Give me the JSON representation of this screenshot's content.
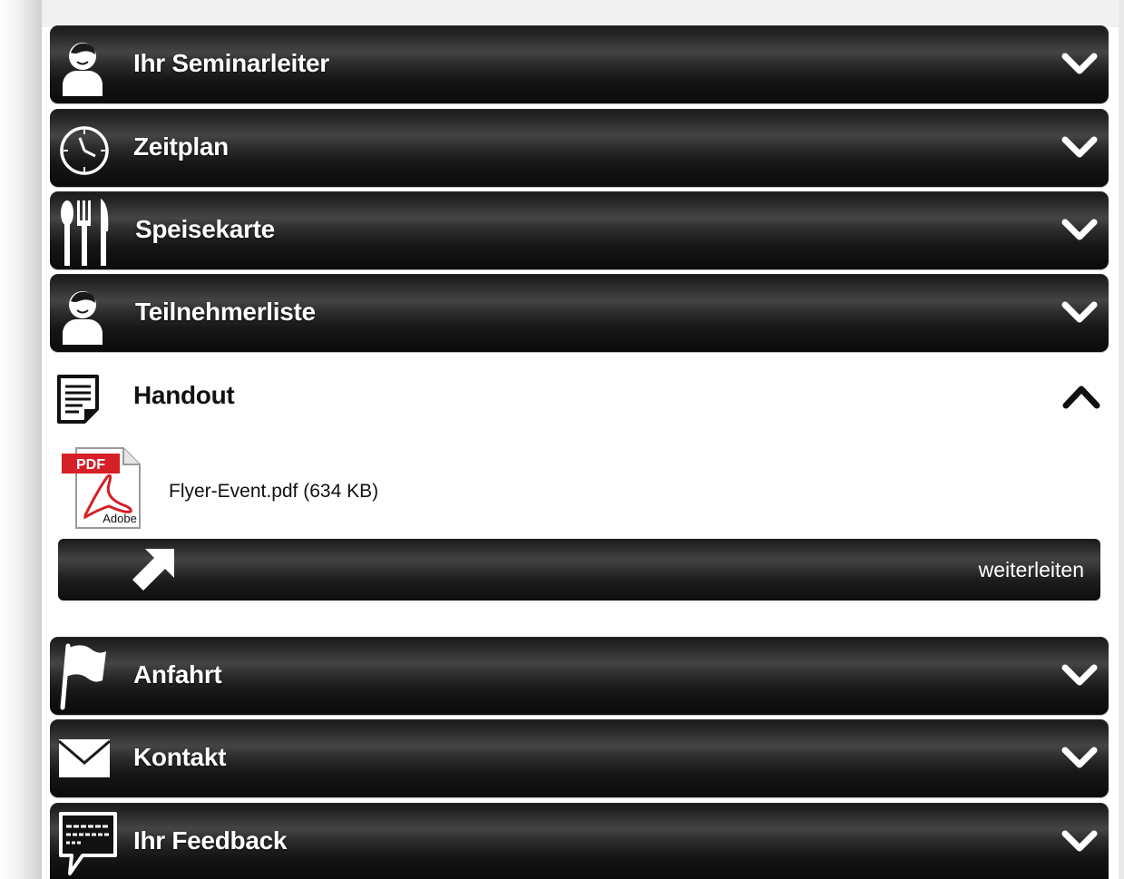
{
  "panels": [
    {
      "label": "Ihr Seminarleiter",
      "icon": "person-icon",
      "expanded": false
    },
    {
      "label": "Zeitplan",
      "icon": "clock-icon",
      "expanded": false
    },
    {
      "label": "Speisekarte",
      "icon": "cutlery-icon",
      "expanded": false
    },
    {
      "label": "Teilnehmerliste",
      "icon": "person-icon",
      "expanded": false
    },
    {
      "label": "Handout",
      "icon": "document-icon",
      "expanded": true
    },
    {
      "label": "Anfahrt",
      "icon": "flag-icon",
      "expanded": false
    },
    {
      "label": "Kontakt",
      "icon": "envelope-icon",
      "expanded": false
    },
    {
      "label": "Ihr Feedback",
      "icon": "feedback-bubble-icon",
      "expanded": false
    }
  ],
  "handout": {
    "file_name": "Flyer-Event.pdf (634 KB)",
    "file_icon": "pdf-icon",
    "pdf_badge": "PDF",
    "pdf_brand": "Adobe",
    "forward_label": "weiterleiten",
    "forward_icon": "forward-arrow-icon"
  },
  "colors": {
    "panel_dark": "#0b0b0b",
    "panel_highlight": "#454545",
    "panel_text": "#ffffff",
    "pdf_red": "#d61f26"
  }
}
